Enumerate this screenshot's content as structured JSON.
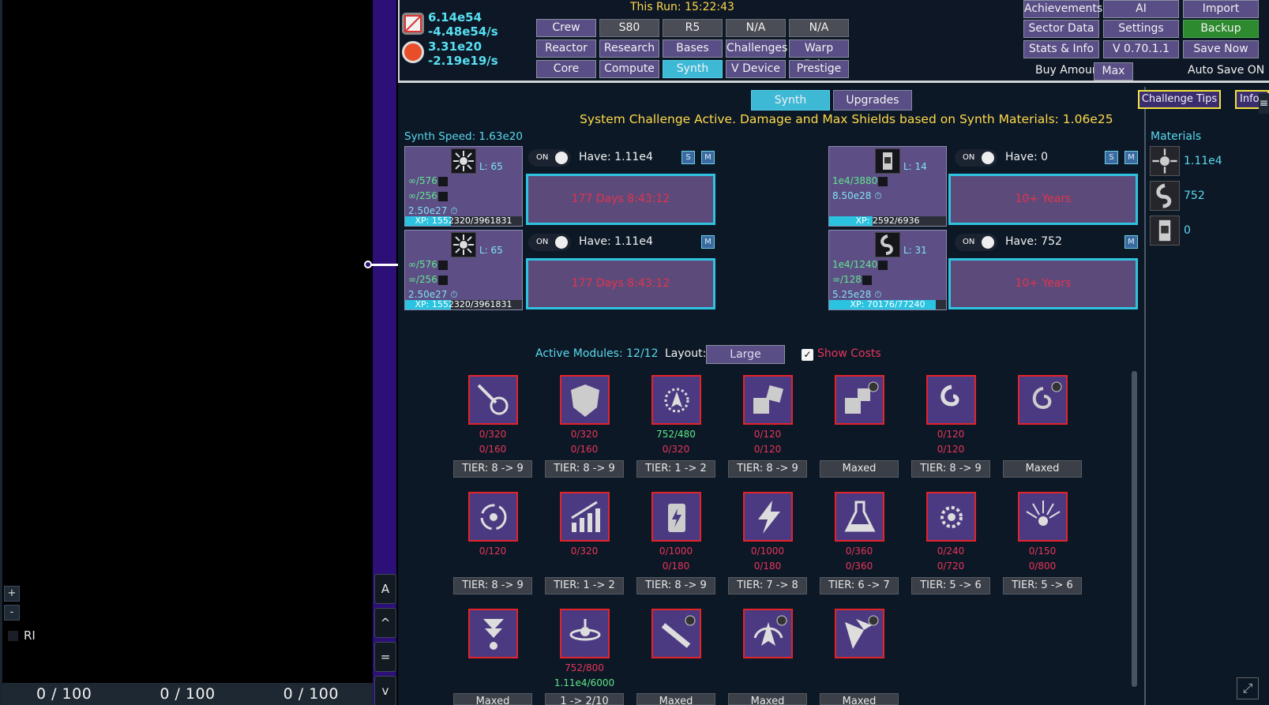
{
  "left_panel": {
    "zoom_in": "+",
    "zoom_out": "-",
    "ri_label": "RI",
    "counters": [
      "0 / 100",
      "0 / 100",
      "0 / 100"
    ],
    "side_buttons": [
      "A",
      "^",
      "=",
      "v"
    ]
  },
  "header": {
    "resource1": {
      "value": "6.14e54",
      "rate": "-4.48e54/s"
    },
    "resource2": {
      "value": "3.31e20",
      "rate": "-2.19e19/s"
    },
    "this_run": "This Run: 15:22:43",
    "nav": [
      [
        "Crew",
        "S80",
        "R5",
        "N/A",
        "N/A"
      ],
      [
        "Reactor",
        "Research",
        "Bases",
        "Challenges",
        "Warp Drive"
      ],
      [
        "Core",
        "Compute",
        "Synth",
        "V Device",
        "Prestige"
      ]
    ],
    "right_buttons": [
      [
        "Achievements",
        "AI",
        "Import"
      ],
      [
        "Sector Data",
        "Settings",
        "Backup"
      ],
      [
        "Stats & Info",
        "V 0.70.1.1",
        "Save Now"
      ]
    ],
    "buy_amount_label": "Buy Amount:",
    "buy_amount_value": "Max",
    "auto_save": "Auto Save ON",
    "colors": {
      "accent": "#3db9d6",
      "nav": "#5a4e86",
      "highlight": "#ffd94a",
      "error": "#e8355a"
    }
  },
  "synth": {
    "tabs": [
      "Synth",
      "Upgrades"
    ],
    "challenge_tips": "Challenge Tips",
    "info": "Info",
    "system_challenge": "System Challenge Active.  Damage and Max Shields based on Synth Materials: 1.06e25",
    "speed": "Synth Speed: 1.63e20",
    "cards": [
      {
        "level": "L: 65",
        "l1": "∞/576",
        "l2": "∞/256",
        "l3": "2.50e27",
        "xp": "XP: 1552320/3961831",
        "xp_frac": 0.39,
        "toggle": "ON",
        "have": "Have: 1.11e4",
        "s": "S",
        "m": "M",
        "time": "177 Days 8:43:12",
        "icon": "burst-icon"
      },
      {
        "level": "L: 65",
        "l1": "∞/576",
        "l2": "∞/256",
        "l3": "2.50e27",
        "xp": "XP: 1552320/3961831",
        "xp_frac": 0.39,
        "toggle": "ON",
        "have": "Have: 1.11e4",
        "m": "M",
        "time": "177 Days 8:43:12",
        "icon": "burst-icon"
      },
      {
        "level": "L: 14",
        "l1": "1e4/3880",
        "l2": "8.50e28",
        "xp": "XP: 2592/6936",
        "xp_frac": 0.37,
        "toggle": "ON",
        "have": "Have: 0",
        "s": "S",
        "m": "M",
        "time": "10+ Years",
        "icon": "canister-icon"
      },
      {
        "level": "L: 31",
        "l1": "1e4/1240",
        "l2": "∞/128",
        "l3": "5.25e28",
        "xp": "XP: 70176/77240",
        "xp_frac": 0.91,
        "toggle": "ON",
        "have": "Have: 752",
        "m": "M",
        "time": "10+ Years",
        "icon": "swirl-icon"
      }
    ],
    "materials_title": "Materials",
    "materials": [
      {
        "icon": "burst-icon",
        "value": "1.11e4"
      },
      {
        "icon": "swirl-icon",
        "value": "752"
      },
      {
        "icon": "canister-icon",
        "value": "0"
      }
    ]
  },
  "modules": {
    "active": "Active Modules: 12/12",
    "layout_label": "Layout:",
    "layout_value": "Large",
    "show_costs": "Show Costs",
    "row1": [
      {
        "icon": "comet-icon",
        "c1": "0/320",
        "c2": "0/160",
        "tier": "TIER: 8 -> 9"
      },
      {
        "icon": "shield-hex-icon",
        "c1": "0/320",
        "c2": "0/160",
        "tier": "TIER: 8 -> 9"
      },
      {
        "icon": "sunburst-ship-icon",
        "c1": "752/480",
        "c1ok": true,
        "c2": "0/320",
        "tier": "TIER: 1 -> 2"
      },
      {
        "icon": "cubes-icon",
        "c1": "0/120",
        "c2": "0/120",
        "tier": "TIER: 8 -> 9"
      },
      {
        "icon": "cubes-locked-icon",
        "tier": "Maxed"
      },
      {
        "icon": "swirl-icon",
        "c1": "0/120",
        "c2": "0/120",
        "tier": "TIER: 8 -> 9"
      },
      {
        "icon": "galaxy-locked-icon",
        "tier": "Maxed"
      }
    ],
    "row2": [
      {
        "icon": "vortex-icon",
        "c1": "0/120",
        "tier": "TIER: 8 -> 9"
      },
      {
        "icon": "chart-up-icon",
        "c1": "0/320",
        "tier": "TIER: 1 -> 2"
      },
      {
        "icon": "battery-icon",
        "c1": "0/1000",
        "c2": "0/180",
        "tier": "TIER: 8 -> 9"
      },
      {
        "icon": "lightning-icon",
        "c1": "0/1000",
        "c2": "0/180",
        "tier": "TIER: 7 -> 8"
      },
      {
        "icon": "flask-icon",
        "c1": "0/360",
        "c2": "0/360",
        "tier": "TIER: 6 -> 7"
      },
      {
        "icon": "gear-burst-icon",
        "c1": "0/240",
        "c2": "0/720",
        "tier": "TIER: 5 -> 6"
      },
      {
        "icon": "sun-rays-icon",
        "c1": "0/150",
        "c2": "0/800",
        "tier": "TIER: 5 -> 6"
      }
    ],
    "row3": [
      {
        "icon": "funnel-icon",
        "tier": "Maxed"
      },
      {
        "icon": "satellite-icon",
        "c1": "752/800",
        "c2": "1.11e4/6000",
        "c2ok": true,
        "tier": "1 -> 2/10"
      },
      {
        "icon": "missile-locked-icon",
        "tier": "Maxed"
      },
      {
        "icon": "ship-locked-icon",
        "tier": "Maxed"
      },
      {
        "icon": "shards-locked-icon",
        "tier": "Maxed"
      }
    ]
  }
}
